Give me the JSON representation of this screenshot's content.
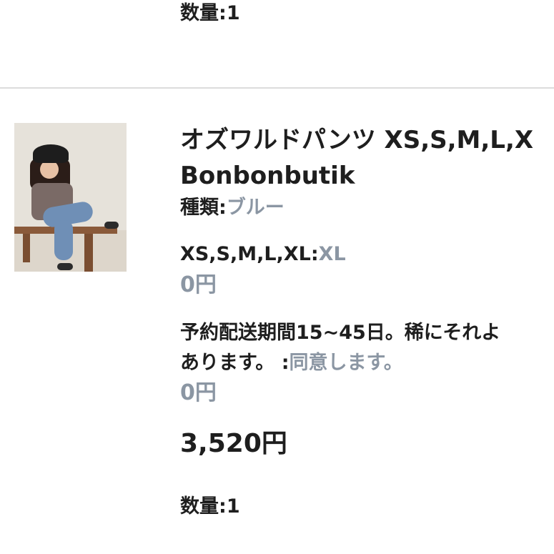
{
  "previous_item": {
    "quantity_label": "数量:",
    "quantity_value": "1"
  },
  "item": {
    "title": "オズワルドパンツ XS,S,M,L,X",
    "shop": "Bonbonbutik",
    "options": [
      {
        "label": "種類:",
        "value": "ブルー"
      },
      {
        "label": "XS,S,M,L,XL:",
        "value": "XL",
        "price": "0円"
      },
      {
        "label": "予約配送期間15~45日。稀にそれよ\nあります。 :",
        "value": "同意します。",
        "price": "0円"
      }
    ],
    "price": "3,520円",
    "quantity_label": "数量:",
    "quantity_value": "1"
  }
}
